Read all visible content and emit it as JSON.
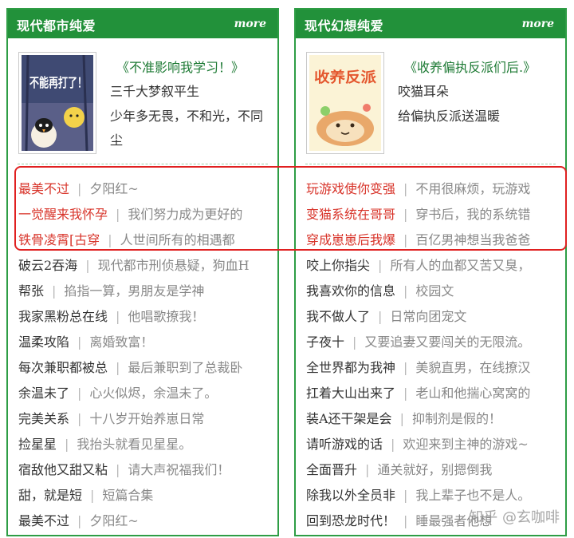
{
  "colors": {
    "header_green": "#22913a",
    "link_green": "#1d7a34",
    "highlight_red": "#e02020",
    "hot_title_red": "#d8342a"
  },
  "left": {
    "title": "现代都市纯爱",
    "more": "more",
    "feature": {
      "cover_text": "不能再打了！",
      "book_title": "《不准影响我学习！》",
      "author": "三千大梦叙平生",
      "desc": "少年多无畏，不和光，不同尘"
    },
    "items": [
      {
        "title": "最美不过",
        "desc": "夕阳红~"
      },
      {
        "title": "一觉醒来我怀孕",
        "desc": "我们努力成为更好的"
      },
      {
        "title": "铁骨凌霄[古穿",
        "desc": "人世间所有的相遇都"
      },
      {
        "title": "破云2吞海",
        "desc": "现代都市刑侦悬疑，狗血H"
      },
      {
        "title": "帮张",
        "desc": "掐指一算，男朋友是学神"
      },
      {
        "title": "我家黑粉总在线",
        "desc": "他唱歌撩我！"
      },
      {
        "title": "温柔攻陷",
        "desc": "离婚致富！"
      },
      {
        "title": "每次兼职都被总",
        "desc": "最后兼职到了总裁卧"
      },
      {
        "title": "余温未了",
        "desc": "心火似烬，余温未了。"
      },
      {
        "title": "完美关系",
        "desc": "十八岁开始养崽日常"
      },
      {
        "title": "捡星星",
        "desc": "我抬头就看见星星。"
      },
      {
        "title": "宿敌他又甜又粘",
        "desc": "请大声祝福我们！"
      },
      {
        "title": "甜，就是短",
        "desc": "短篇合集"
      },
      {
        "title": "最美不过",
        "desc": "夕阳红~"
      }
    ]
  },
  "right": {
    "title": "现代幻想纯爱",
    "more": "more",
    "feature": {
      "cover_text": "收养反派",
      "book_title": "《收养偏执反派们后.》",
      "author": "咬猫耳朵",
      "desc": "给偏执反派送温暖"
    },
    "items": [
      {
        "title": "玩游戏使你变强",
        "desc": "不用很麻烦，玩游戏"
      },
      {
        "title": "变猫系统在哥哥",
        "desc": "穿书后，我的系统错"
      },
      {
        "title": "穿成崽崽后我爆",
        "desc": "百亿男神想当我爸爸"
      },
      {
        "title": "咬上你指尖",
        "desc": "所有人的血都又苦又臭，"
      },
      {
        "title": "我喜欢你的信息",
        "desc": "校园文"
      },
      {
        "title": "我不做人了",
        "desc": "日常向团宠文"
      },
      {
        "title": "子夜十",
        "desc": "又要追妻又要闯关的无限流。"
      },
      {
        "title": "全世界都为我神",
        "desc": "美貌直男，在线撩汉"
      },
      {
        "title": "扛着大山出来了",
        "desc": "老山和他揣心窝窝的"
      },
      {
        "title": "装A还干架是会",
        "desc": "抑制剂是假的！"
      },
      {
        "title": "请听游戏的话",
        "desc": "欢迎来到主神的游戏~"
      },
      {
        "title": "全面晋升",
        "desc": "通关就好，别摁倒我"
      },
      {
        "title": "除我以外全员非",
        "desc": "我上辈子也不是人。"
      },
      {
        "title": "回到恐龙时代！",
        "desc": "睡最强者他想"
      }
    ]
  },
  "watermark": "知乎 @玄咖啡"
}
